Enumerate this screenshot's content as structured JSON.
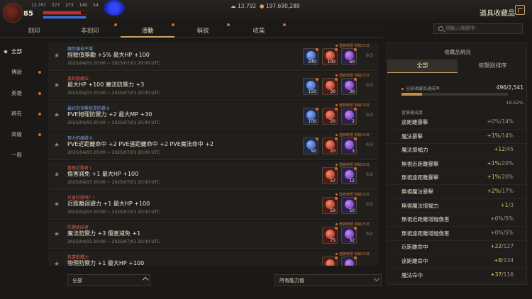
{
  "player": {
    "level": "85",
    "hp_percent": 88,
    "mp_percent": 100,
    "stats": [
      "12,767",
      "277",
      "273",
      "140",
      "54"
    ]
  },
  "currency": {
    "silver": "13,792",
    "gold": "197,690,288"
  },
  "page_title": "道具收藏品",
  "tabs": [
    {
      "label": "刻印",
      "dot": false
    },
    {
      "label": "非刻印",
      "dot": true
    },
    {
      "label": "活動",
      "dot": true,
      "active": true
    },
    {
      "label": "稱號",
      "dot": true
    },
    {
      "label": "收集",
      "dot": true
    }
  ],
  "search": {
    "placeholder": "請輸入關鍵字."
  },
  "sidebar": [
    {
      "label": "全部",
      "active": true,
      "dot": false
    },
    {
      "label": "傳說",
      "dot": true
    },
    {
      "label": "英雄",
      "dot": true
    },
    {
      "label": "稀有",
      "dot": true
    },
    {
      "label": "高級",
      "dot": true
    },
    {
      "label": "一般",
      "dot": false
    }
  ],
  "cards": [
    {
      "category": "讓你痛苦不堪",
      "cat_color": "#7ea3e8",
      "effect": "經驗值獎勵 +5% 最大HP +100",
      "date": "2025/04/03 20:00 ~ 2025/07/01 20:00 UTC",
      "tag": "登錄時限 剩餘25日",
      "progress": "0/3",
      "slots": [
        {
          "c": "blue",
          "n": "240"
        },
        {
          "c": "red",
          "n": "100"
        },
        {
          "c": "purple",
          "n": "60"
        }
      ]
    },
    {
      "category": "真封層魔法",
      "cat_color": "#e05a4a",
      "effect": "最大HP +100 魔法防禦力 +3",
      "date": "2025/04/03 20:00 ~ 2025/07/01 20:00 UTC",
      "tag": "登錄時限 剩餘25日",
      "progress": "0/3",
      "slots": [
        {
          "c": "blue",
          "n": "150"
        },
        {
          "c": "red",
          "n": "30"
        },
        {
          "c": "purple",
          "n": "30"
        }
      ]
    },
    {
      "category": "最好的攻擊就是防禦 II",
      "cat_color": "#7ea3e8",
      "effect": "PVE物理防禦力 +2 最大MP +30",
      "date": "2025/04/03 20:00 ~ 2025/07/01 20:00 UTC",
      "tag": "登錄時限 剩餘25日",
      "progress": "0/3",
      "slots": [
        {
          "c": "blue",
          "n": "100"
        },
        {
          "c": "red",
          "n": "20"
        },
        {
          "c": "purple",
          "n": "2"
        }
      ]
    },
    {
      "category": "努力的痕跡 II",
      "cat_color": "#7ea3e8",
      "effect": "PVE近距離命中 +2 PVE遠距離命中 +2 PVE魔法命中 +2",
      "date": "2025/04/03 20:00 ~ 2025/07/01 20:00 UTC",
      "tag": "登錄時限 剩餘25日",
      "progress": "0/3",
      "slots": [
        {
          "c": "blue",
          "n": "90"
        },
        {
          "c": "red",
          "n": "20"
        },
        {
          "c": "purple",
          "n": "3"
        }
      ]
    },
    {
      "category": "喜極近服者 I",
      "cat_color": "#e05a4a",
      "effect": "傷害減免 +1 最大HP +100",
      "date": "2025/04/03 20:00 ~ 2025/07/01 20:00 UTC",
      "tag": "登錄時限 剩餘25日",
      "progress": "0/2",
      "slots": [
        {
          "c": "red",
          "n": "57"
        },
        {
          "c": "purple",
          "n": "12"
        }
      ]
    },
    {
      "category": "只會防禦嗎？I",
      "cat_color": "#e05a4a",
      "effect": "近距離迴避力 +1 最大HP +100",
      "date": "2025/04/03 20:00 ~ 2025/07/01 20:00 UTC",
      "tag": "登錄時限 剩餘25日",
      "progress": "0/2",
      "slots": [
        {
          "c": "red",
          "n": "50"
        },
        {
          "c": "purple",
          "n": "50"
        }
      ]
    },
    {
      "category": "防禦終結者",
      "cat_color": "#e05a4a",
      "effect": "魔法防禦力 +3 傷害減免 +1",
      "date": "2025/04/03 20:00 ~ 2025/07/01 20:00 UTC",
      "tag": "登錄時限 剩餘25日",
      "progress": "0/2",
      "slots": [
        {
          "c": "red",
          "n": "75"
        },
        {
          "c": "purple",
          "n": "32"
        }
      ]
    },
    {
      "category": "我喜歡體力",
      "cat_color": "#e05a4a",
      "effect": "物理防禦力 +1 最大HP +100",
      "date": "",
      "tag": "登錄時限 剩餘25日",
      "progress": "",
      "slots": [
        {
          "c": "red",
          "n": ""
        },
        {
          "c": "purple",
          "n": ""
        }
      ]
    }
  ],
  "filters": {
    "left": "全部",
    "right": "所有能力值"
  },
  "panel": {
    "title": "收藏品現況",
    "tabs": [
      "全部",
      "依類別排序"
    ],
    "total_label": "全部收藏品達成率",
    "total_value": "496/2,541",
    "total_fraction": 0.195,
    "total_pct": "19.52%",
    "section_label": "習慣達成度",
    "stats": [
      {
        "name": "遠距離暴擊",
        "val": "+0%",
        "max": "/14%"
      },
      {
        "name": "魔法暴擊",
        "val": "+1%",
        "max": "/14%",
        "hl": true
      },
      {
        "name": "魔法增幅力",
        "val": "+12",
        "max": "/45",
        "hl": true
      },
      {
        "name": "無視近距離暴擊",
        "val": "+1%",
        "max": "/20%",
        "hl": true
      },
      {
        "name": "無視遠距離暴擊",
        "val": "+1%",
        "max": "/20%",
        "hl": true
      },
      {
        "name": "無視魔法暴擊",
        "val": "+2%",
        "max": "/17%",
        "hl": true
      },
      {
        "name": "無視魔法增幅力",
        "val": "+1",
        "max": "/3",
        "hl": true
      },
      {
        "name": "無視近距離增幅傷害",
        "val": "+0%",
        "max": "/5%"
      },
      {
        "name": "無視遠距離增幅傷害",
        "val": "+0%",
        "max": "/5%"
      },
      {
        "name": "近距離命中",
        "val": "+22",
        "max": "/127",
        "hl": true
      },
      {
        "name": "遠距離命中",
        "val": "+8",
        "max": "/134",
        "hl": true
      },
      {
        "name": "魔法命中",
        "val": "+37",
        "max": "/116",
        "hl": true
      }
    ]
  }
}
